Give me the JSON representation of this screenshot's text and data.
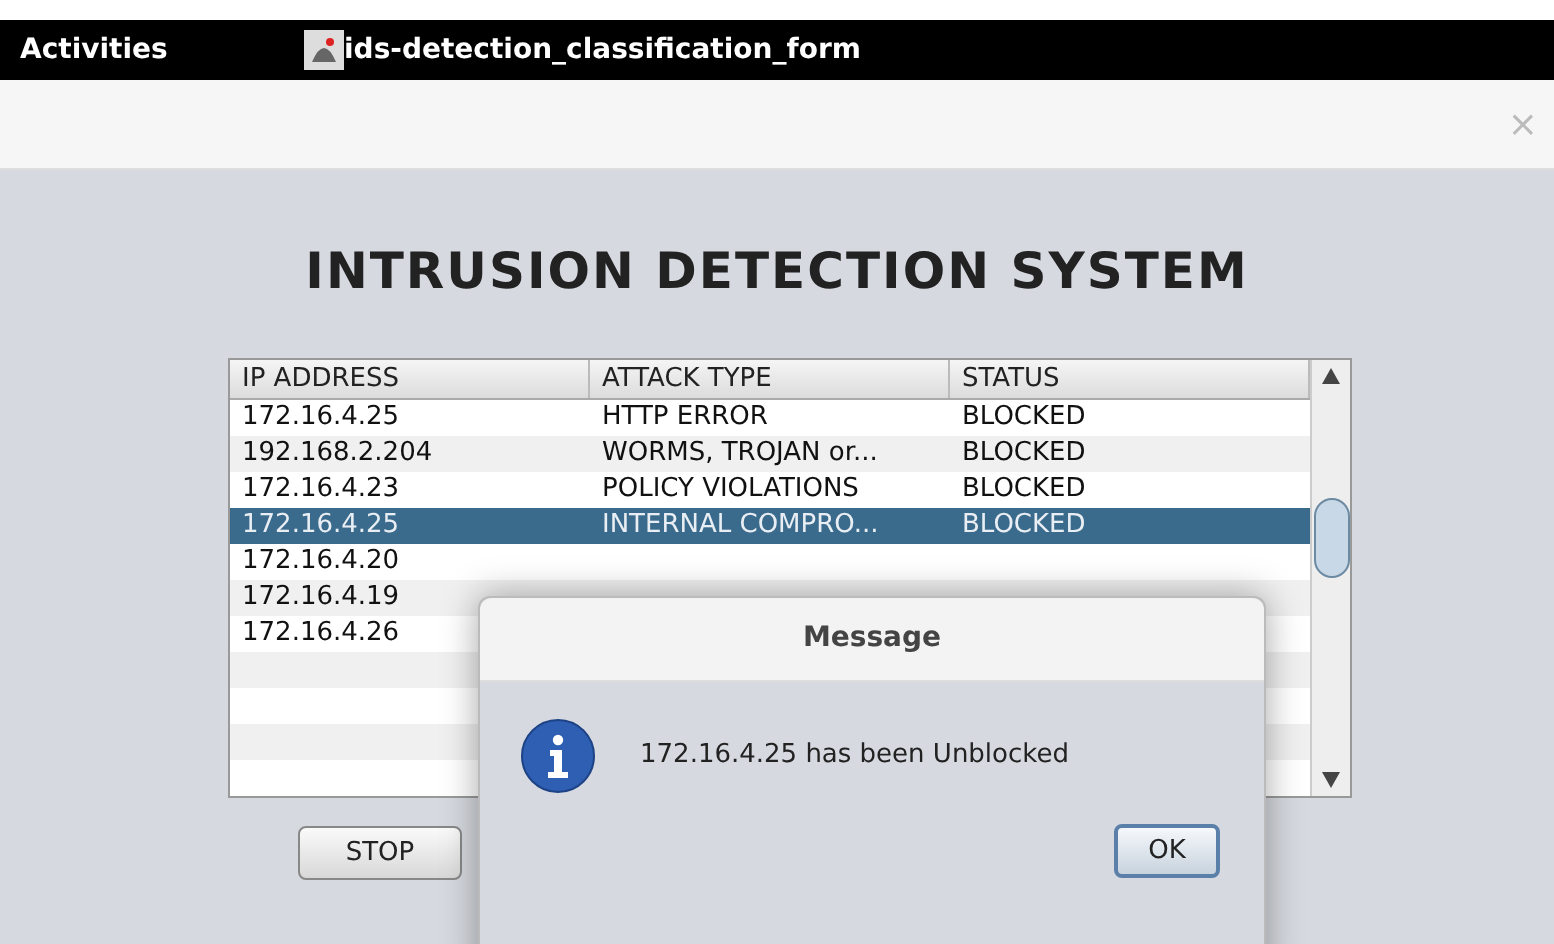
{
  "top_bar": {
    "activities": "Activities",
    "app_title": "ids-detection_classification_form"
  },
  "window": {
    "close": "×"
  },
  "heading": "INTRUSION DETECTION SYSTEM",
  "table": {
    "columns": [
      "IP ADDRESS",
      "ATTACK TYPE",
      "STATUS"
    ],
    "rows": [
      {
        "cells": [
          "172.16.4.25",
          "HTTP ERROR",
          "BLOCKED"
        ],
        "selected": false
      },
      {
        "cells": [
          "192.168.2.204",
          "WORMS, TROJAN or...",
          "BLOCKED"
        ],
        "selected": false
      },
      {
        "cells": [
          "172.16.4.23",
          "POLICY VIOLATIONS",
          "BLOCKED"
        ],
        "selected": false
      },
      {
        "cells": [
          "172.16.4.25",
          "INTERNAL COMPRO...",
          "BLOCKED"
        ],
        "selected": true
      },
      {
        "cells": [
          "172.16.4.20"
        ],
        "selected": false
      },
      {
        "cells": [
          "172.16.4.19"
        ],
        "selected": false
      },
      {
        "cells": [
          "172.16.4.26"
        ],
        "selected": false
      },
      {
        "cells": [],
        "selected": false
      },
      {
        "cells": [],
        "selected": false
      },
      {
        "cells": [],
        "selected": false
      },
      {
        "cells": [],
        "selected": false
      }
    ]
  },
  "buttons": [
    "STOP"
  ],
  "dialog": {
    "title": "Message",
    "message": "172.16.4.25 has been Unblocked",
    "button": "OK"
  }
}
